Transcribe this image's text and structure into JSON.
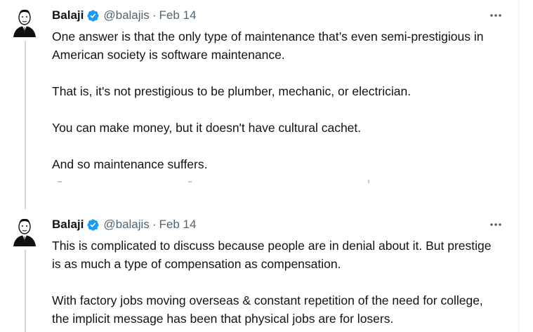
{
  "tweets": [
    {
      "name": "Balaji",
      "handle": "@balajis",
      "separator": "·",
      "date": "Feb 14",
      "paragraphs": [
        "One answer is that the only type of maintenance that’s even semi-prestigious in American society is software maintenance.",
        "That is, it's not prestigious to be plumber, mechanic, or electrician.",
        "You can make money, but it doesn't have cultural cachet.",
        "And so maintenance suffers."
      ]
    },
    {
      "name": "Balaji",
      "handle": "@balajis",
      "separator": "·",
      "date": "Feb 14",
      "paragraphs": [
        "This is complicated to discuss because people are in denial about it. But prestige is as much a type of compensation as compensation.",
        "With factory jobs moving overseas & constant repetition of the need for college, the implicit message has been that physical jobs are for losers."
      ]
    }
  ],
  "icons": {
    "verified": "verified-badge-icon",
    "more": "more-horizontal-icon",
    "avatar": "avatar"
  },
  "colors": {
    "verified": "#1d9bf0",
    "secondary_text": "#536471",
    "thread_line": "#cfd9de"
  }
}
